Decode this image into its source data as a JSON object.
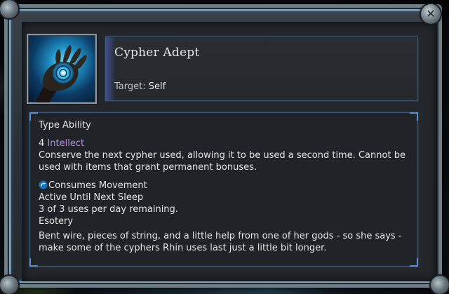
{
  "tooltip": {
    "title": "Cypher Adept",
    "target_label": "Target:",
    "target_value": "Self",
    "close_icon": "close-icon",
    "portrait_icon": "glowing-hand-icon",
    "type_line": "Type Ability",
    "cost_amount": "4",
    "cost_stat": "Intellect",
    "description": "Conserve the next cypher used, allowing it to be used a second time. Cannot be used with items that grant permanent bonuses.",
    "movement_icon": "movement-icon",
    "consumes": "Consumes Movement",
    "duration": "Active Until Next Sleep",
    "uses": "3 of 3 uses per day remaining.",
    "school": "Esotery",
    "flavor": "Bent wire, pieces of string, and a little help from one of her gods - so she says - make some of the cyphers Rhin uses last just a little bit longer."
  },
  "colors": {
    "accent_border": "#3b5876",
    "stat_color": "#b58fe0",
    "glow": "#4a8fb5"
  }
}
